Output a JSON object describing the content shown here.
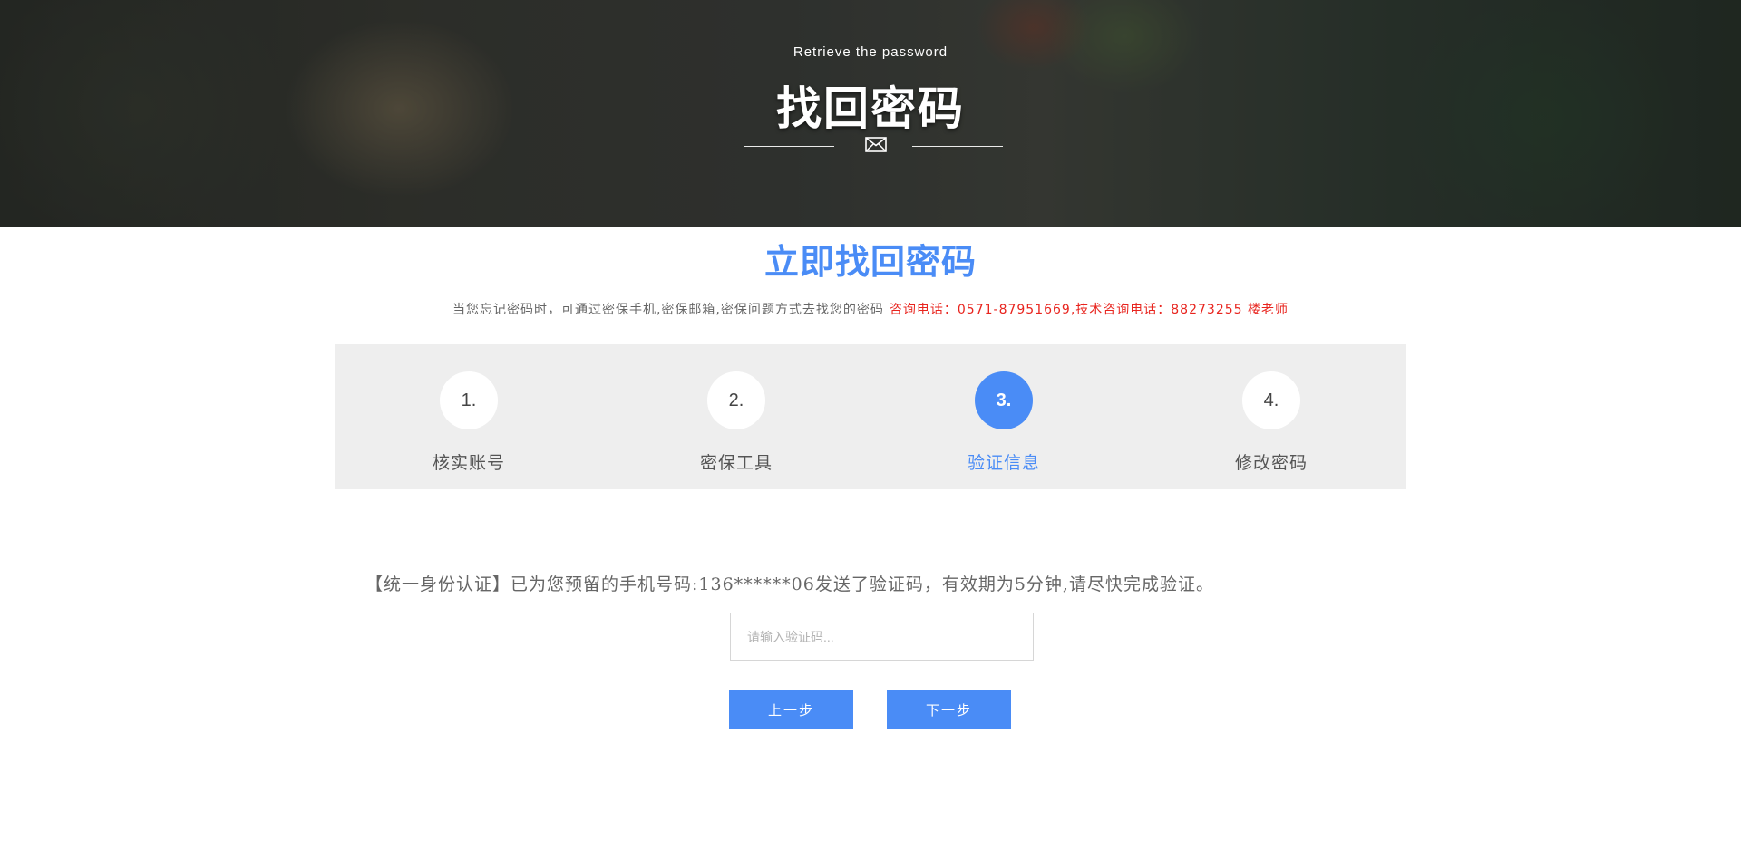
{
  "banner": {
    "subtitle": "Retrieve the password",
    "title": "找回密码",
    "icon": "envelope-icon"
  },
  "main": {
    "heading": "立即找回密码",
    "notice": "当您忘记密码时，可通过密保手机,密保邮箱,密保问题方式去找您的密码",
    "notice_contact": "咨询电话：0571-87951669,技术咨询电话：88273255 楼老师"
  },
  "steps": [
    {
      "number": "1.",
      "label": "核实账号",
      "active": false
    },
    {
      "number": "2.",
      "label": "密保工具",
      "active": false
    },
    {
      "number": "3.",
      "label": "验证信息",
      "active": true
    },
    {
      "number": "4.",
      "label": "修改密码",
      "active": false
    }
  ],
  "verify": {
    "message": "【统一身份认证】已为您预留的手机号码:136******06发送了验证码，有效期为5分钟,请尽快完成验证。",
    "code_value": "",
    "code_placeholder": "请输入验证码...",
    "prev_label": "上一步",
    "next_label": "下一步"
  },
  "colors": {
    "accent": "#4a8cf6",
    "contact_red": "#e8241e",
    "steps_bg": "#eeeeee"
  }
}
